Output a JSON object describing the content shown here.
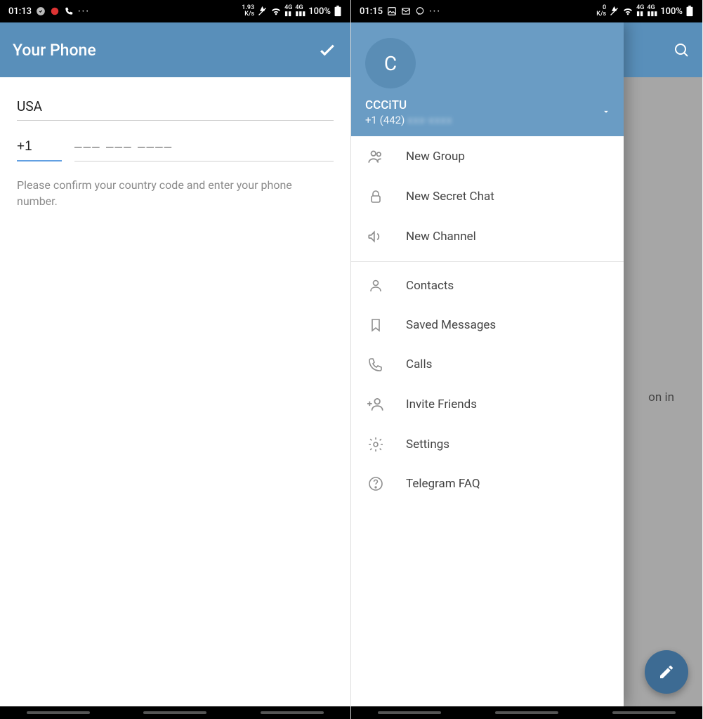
{
  "left": {
    "status": {
      "time": "01:13",
      "speed_top": "1.93",
      "speed_unit": "K/s",
      "network": "4G",
      "battery": "100%"
    },
    "header": {
      "title": "Your Phone"
    },
    "form": {
      "country": "USA",
      "country_code": "+1",
      "phone_placeholder": "––– ––– ––––",
      "hint": "Please confirm your country code and enter your phone number."
    }
  },
  "right": {
    "status": {
      "time": "01:15",
      "speed_top": "0",
      "speed_unit": "K/s",
      "network": "4G",
      "battery": "100%"
    },
    "drawer": {
      "avatar_initial": "C",
      "username": "CCCiTU",
      "phone_visible": "+1 (442)",
      "menu": [
        {
          "label": "New Group"
        },
        {
          "label": "New Secret Chat"
        },
        {
          "label": "New Channel"
        },
        {
          "label": "Contacts"
        },
        {
          "label": "Saved Messages"
        },
        {
          "label": "Calls"
        },
        {
          "label": "Invite Friends"
        },
        {
          "label": "Settings"
        },
        {
          "label": "Telegram FAQ"
        }
      ]
    },
    "underlying": {
      "partial_text": "on in"
    }
  }
}
